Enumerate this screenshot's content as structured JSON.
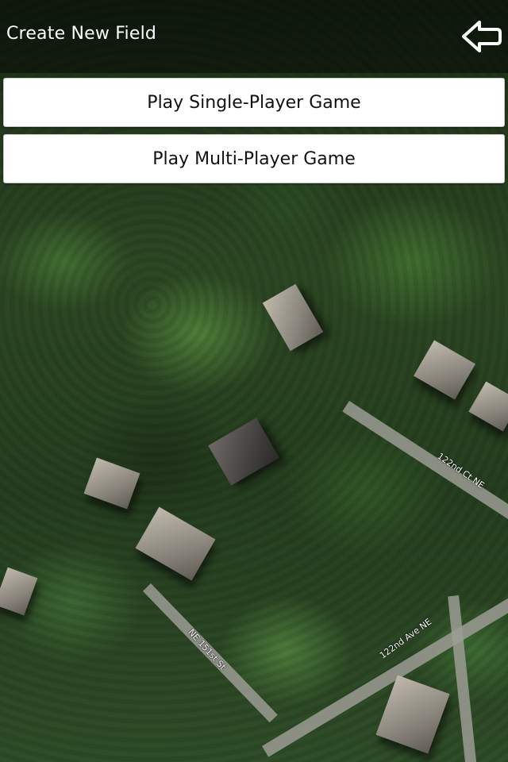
{
  "header": {
    "title": "Create New Field",
    "back_icon": "back-arrow-icon"
  },
  "menu": {
    "single_player_label": "Play Single-Player Game",
    "multi_player_label": "Play Multi-Player Game"
  },
  "map": {
    "type": "satellite",
    "street_labels": {
      "street_1": "122nd Ct NE",
      "street_2": "122nd Ave NE",
      "street_3": "NE 151st St"
    }
  },
  "colors": {
    "header_overlay": "#000000",
    "button_background": "#ffffff",
    "button_text": "#111111",
    "title_text": "#ffffff"
  }
}
